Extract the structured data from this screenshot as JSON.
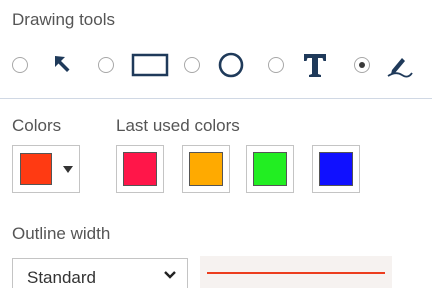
{
  "drawing_tools": {
    "label": "Drawing tools",
    "tools": [
      {
        "name": "pointer",
        "icon": "arrow-pointer-icon",
        "selected": false
      },
      {
        "name": "rectangle",
        "icon": "rectangle-icon",
        "selected": false
      },
      {
        "name": "ellipse",
        "icon": "circle-icon",
        "selected": false
      },
      {
        "name": "text",
        "icon": "text-t-icon",
        "selected": false
      },
      {
        "name": "freehand",
        "icon": "pen-icon",
        "selected": true
      }
    ]
  },
  "colors": {
    "label": "Colors",
    "current": "#ff3a12"
  },
  "last_used_colors": {
    "label": "Last used colors",
    "swatches": [
      "#ff1649",
      "#ffaa00",
      "#22ee22",
      "#1010ff"
    ]
  },
  "outline_width": {
    "label": "Outline width",
    "selected": "Standard",
    "preview_color": "#ec3d1e"
  },
  "theme": {
    "icon_color": "#1f3a5a",
    "divider": "#d0d8e4"
  }
}
